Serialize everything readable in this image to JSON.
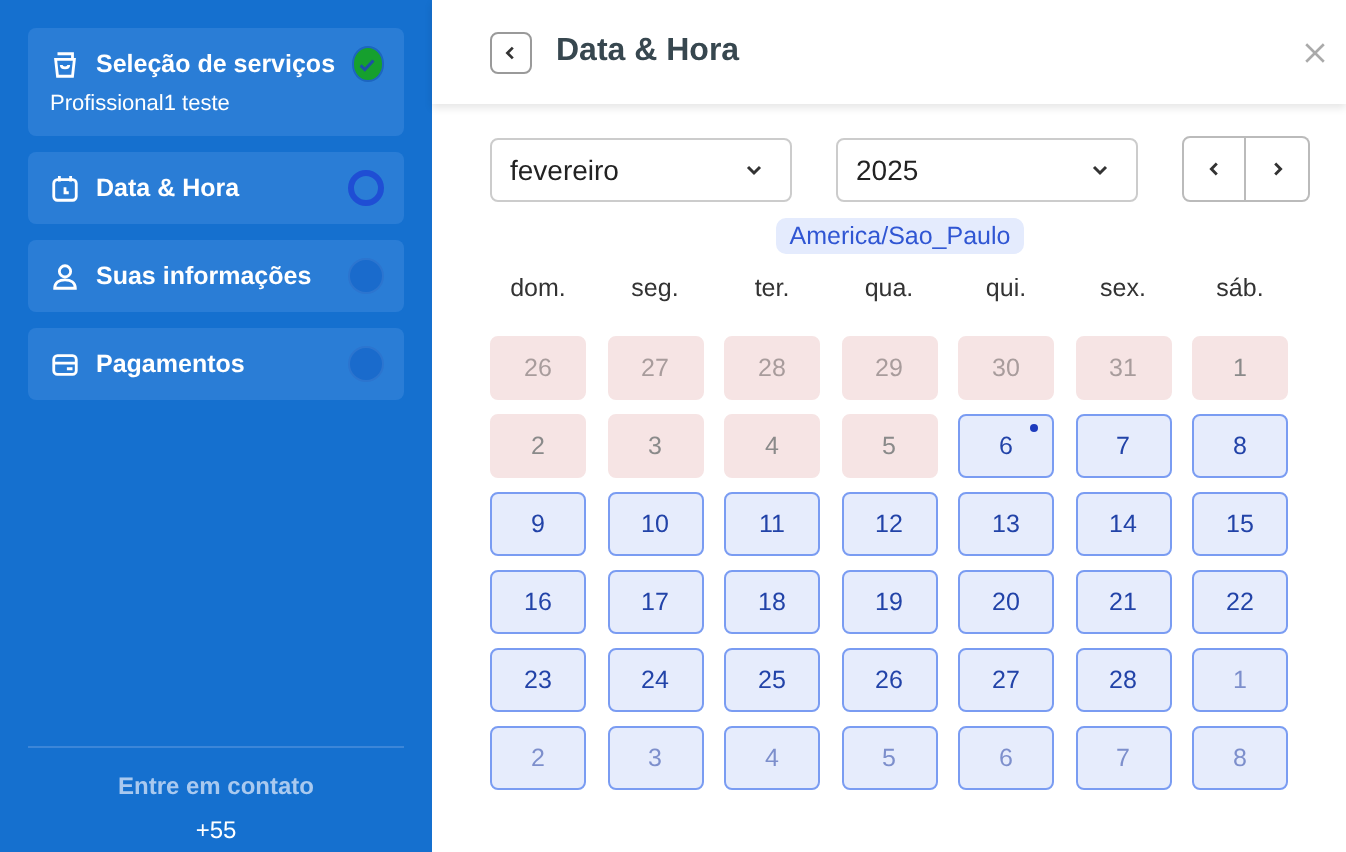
{
  "sidebar": {
    "steps": [
      {
        "label": "Seleção de serviços",
        "subtitle": "Profissional1 teste",
        "kind": "done"
      },
      {
        "label": "Data & Hora",
        "kind": "current"
      },
      {
        "label": "Suas informações",
        "kind": "pending"
      },
      {
        "label": "Pagamentos",
        "kind": "pending"
      }
    ],
    "contact_title": "Entre em contato",
    "contact_phone": "+55"
  },
  "panel": {
    "title": "Data & Hora",
    "month": "fevereiro",
    "year": "2025",
    "timezone": "America/Sao_Paulo",
    "weekdays": [
      "dom.",
      "seg.",
      "ter.",
      "qua.",
      "qui.",
      "sex.",
      "sáb."
    ],
    "days": [
      {
        "label": "26",
        "outside": true,
        "available": false,
        "today": false
      },
      {
        "label": "27",
        "outside": true,
        "available": false,
        "today": false
      },
      {
        "label": "28",
        "outside": true,
        "available": false,
        "today": false
      },
      {
        "label": "29",
        "outside": true,
        "available": false,
        "today": false
      },
      {
        "label": "30",
        "outside": true,
        "available": false,
        "today": false
      },
      {
        "label": "31",
        "outside": true,
        "available": false,
        "today": false
      },
      {
        "label": "1",
        "outside": false,
        "available": false,
        "today": false
      },
      {
        "label": "2",
        "outside": false,
        "available": false,
        "today": false
      },
      {
        "label": "3",
        "outside": false,
        "available": false,
        "today": false
      },
      {
        "label": "4",
        "outside": false,
        "available": false,
        "today": false
      },
      {
        "label": "5",
        "outside": false,
        "available": false,
        "today": false
      },
      {
        "label": "6",
        "outside": false,
        "available": true,
        "today": true
      },
      {
        "label": "7",
        "outside": false,
        "available": true,
        "today": false
      },
      {
        "label": "8",
        "outside": false,
        "available": true,
        "today": false
      },
      {
        "label": "9",
        "outside": false,
        "available": true,
        "today": false
      },
      {
        "label": "10",
        "outside": false,
        "available": true,
        "today": false
      },
      {
        "label": "11",
        "outside": false,
        "available": true,
        "today": false
      },
      {
        "label": "12",
        "outside": false,
        "available": true,
        "today": false
      },
      {
        "label": "13",
        "outside": false,
        "available": true,
        "today": false
      },
      {
        "label": "14",
        "outside": false,
        "available": true,
        "today": false
      },
      {
        "label": "15",
        "outside": false,
        "available": true,
        "today": false
      },
      {
        "label": "16",
        "outside": false,
        "available": true,
        "today": false
      },
      {
        "label": "17",
        "outside": false,
        "available": true,
        "today": false
      },
      {
        "label": "18",
        "outside": false,
        "available": true,
        "today": false
      },
      {
        "label": "19",
        "outside": false,
        "available": true,
        "today": false
      },
      {
        "label": "20",
        "outside": false,
        "available": true,
        "today": false
      },
      {
        "label": "21",
        "outside": false,
        "available": true,
        "today": false
      },
      {
        "label": "22",
        "outside": false,
        "available": true,
        "today": false
      },
      {
        "label": "23",
        "outside": false,
        "available": true,
        "today": false
      },
      {
        "label": "24",
        "outside": false,
        "available": true,
        "today": false
      },
      {
        "label": "25",
        "outside": false,
        "available": true,
        "today": false
      },
      {
        "label": "26",
        "outside": false,
        "available": true,
        "today": false
      },
      {
        "label": "27",
        "outside": false,
        "available": true,
        "today": false
      },
      {
        "label": "28",
        "outside": false,
        "available": true,
        "today": false
      },
      {
        "label": "1",
        "outside": true,
        "available": true,
        "today": false
      },
      {
        "label": "2",
        "outside": true,
        "available": true,
        "today": false
      },
      {
        "label": "3",
        "outside": true,
        "available": true,
        "today": false
      },
      {
        "label": "4",
        "outside": true,
        "available": true,
        "today": false
      },
      {
        "label": "5",
        "outside": true,
        "available": true,
        "today": false
      },
      {
        "label": "6",
        "outside": true,
        "available": true,
        "today": false
      },
      {
        "label": "7",
        "outside": true,
        "available": true,
        "today": false
      },
      {
        "label": "8",
        "outside": true,
        "available": true,
        "today": false
      }
    ]
  }
}
